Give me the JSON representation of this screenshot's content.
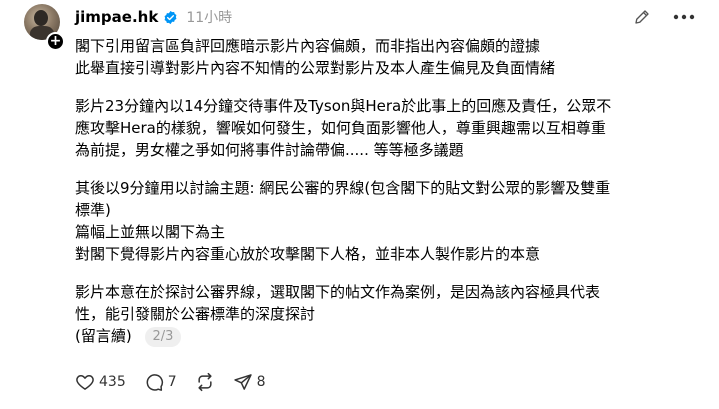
{
  "author": {
    "username": "jimpae.hk",
    "time": "11小時"
  },
  "post": {
    "para1": [
      "閣下引用留言區負評回應暗示影片內容偏頗，而非指出內容偏頗的證據",
      "此舉直接引導對影片內容不知情的公眾對影片及本人產生偏見及負面情緒"
    ],
    "para2": [
      "影片23分鐘內以14分鐘交待事件及Tyson與Hera於此事上的回應及責任，公眾不",
      "應攻擊Hera的樣貌，響喉如何發生，如何負面影響他人，尊重興趣需以互相尊重",
      "為前提，男女權之爭如何將事件討論帶偏..... 等等極多議題"
    ],
    "para3": [
      "其後以9分鐘用以討論主題: 網民公審的界線(包含閣下的貼文對公眾的影響及雙重",
      "標準)",
      "篇幅上並無以閣下為主",
      "對閣下覺得影片內容重心放於攻擊閣下人格，並非本人製作影片的本意"
    ],
    "para4": [
      "影片本意在於探討公審界線，選取閣下的帖文作為案例，是因為該內容極具代表",
      "性，能引發關於公審標準的深度探討"
    ],
    "continued": "(留言續)",
    "page_indicator": "2/3"
  },
  "actions": {
    "likes": "435",
    "comments": "7",
    "shares": "8"
  },
  "colors": {
    "verified": "#0095f6",
    "secondary_text": "#999999",
    "badge_bg": "#efefef"
  },
  "icons": [
    "edit-icon",
    "more-icon",
    "heart-icon",
    "comment-icon",
    "repost-icon",
    "share-icon",
    "verified-icon",
    "plus-icon"
  ]
}
